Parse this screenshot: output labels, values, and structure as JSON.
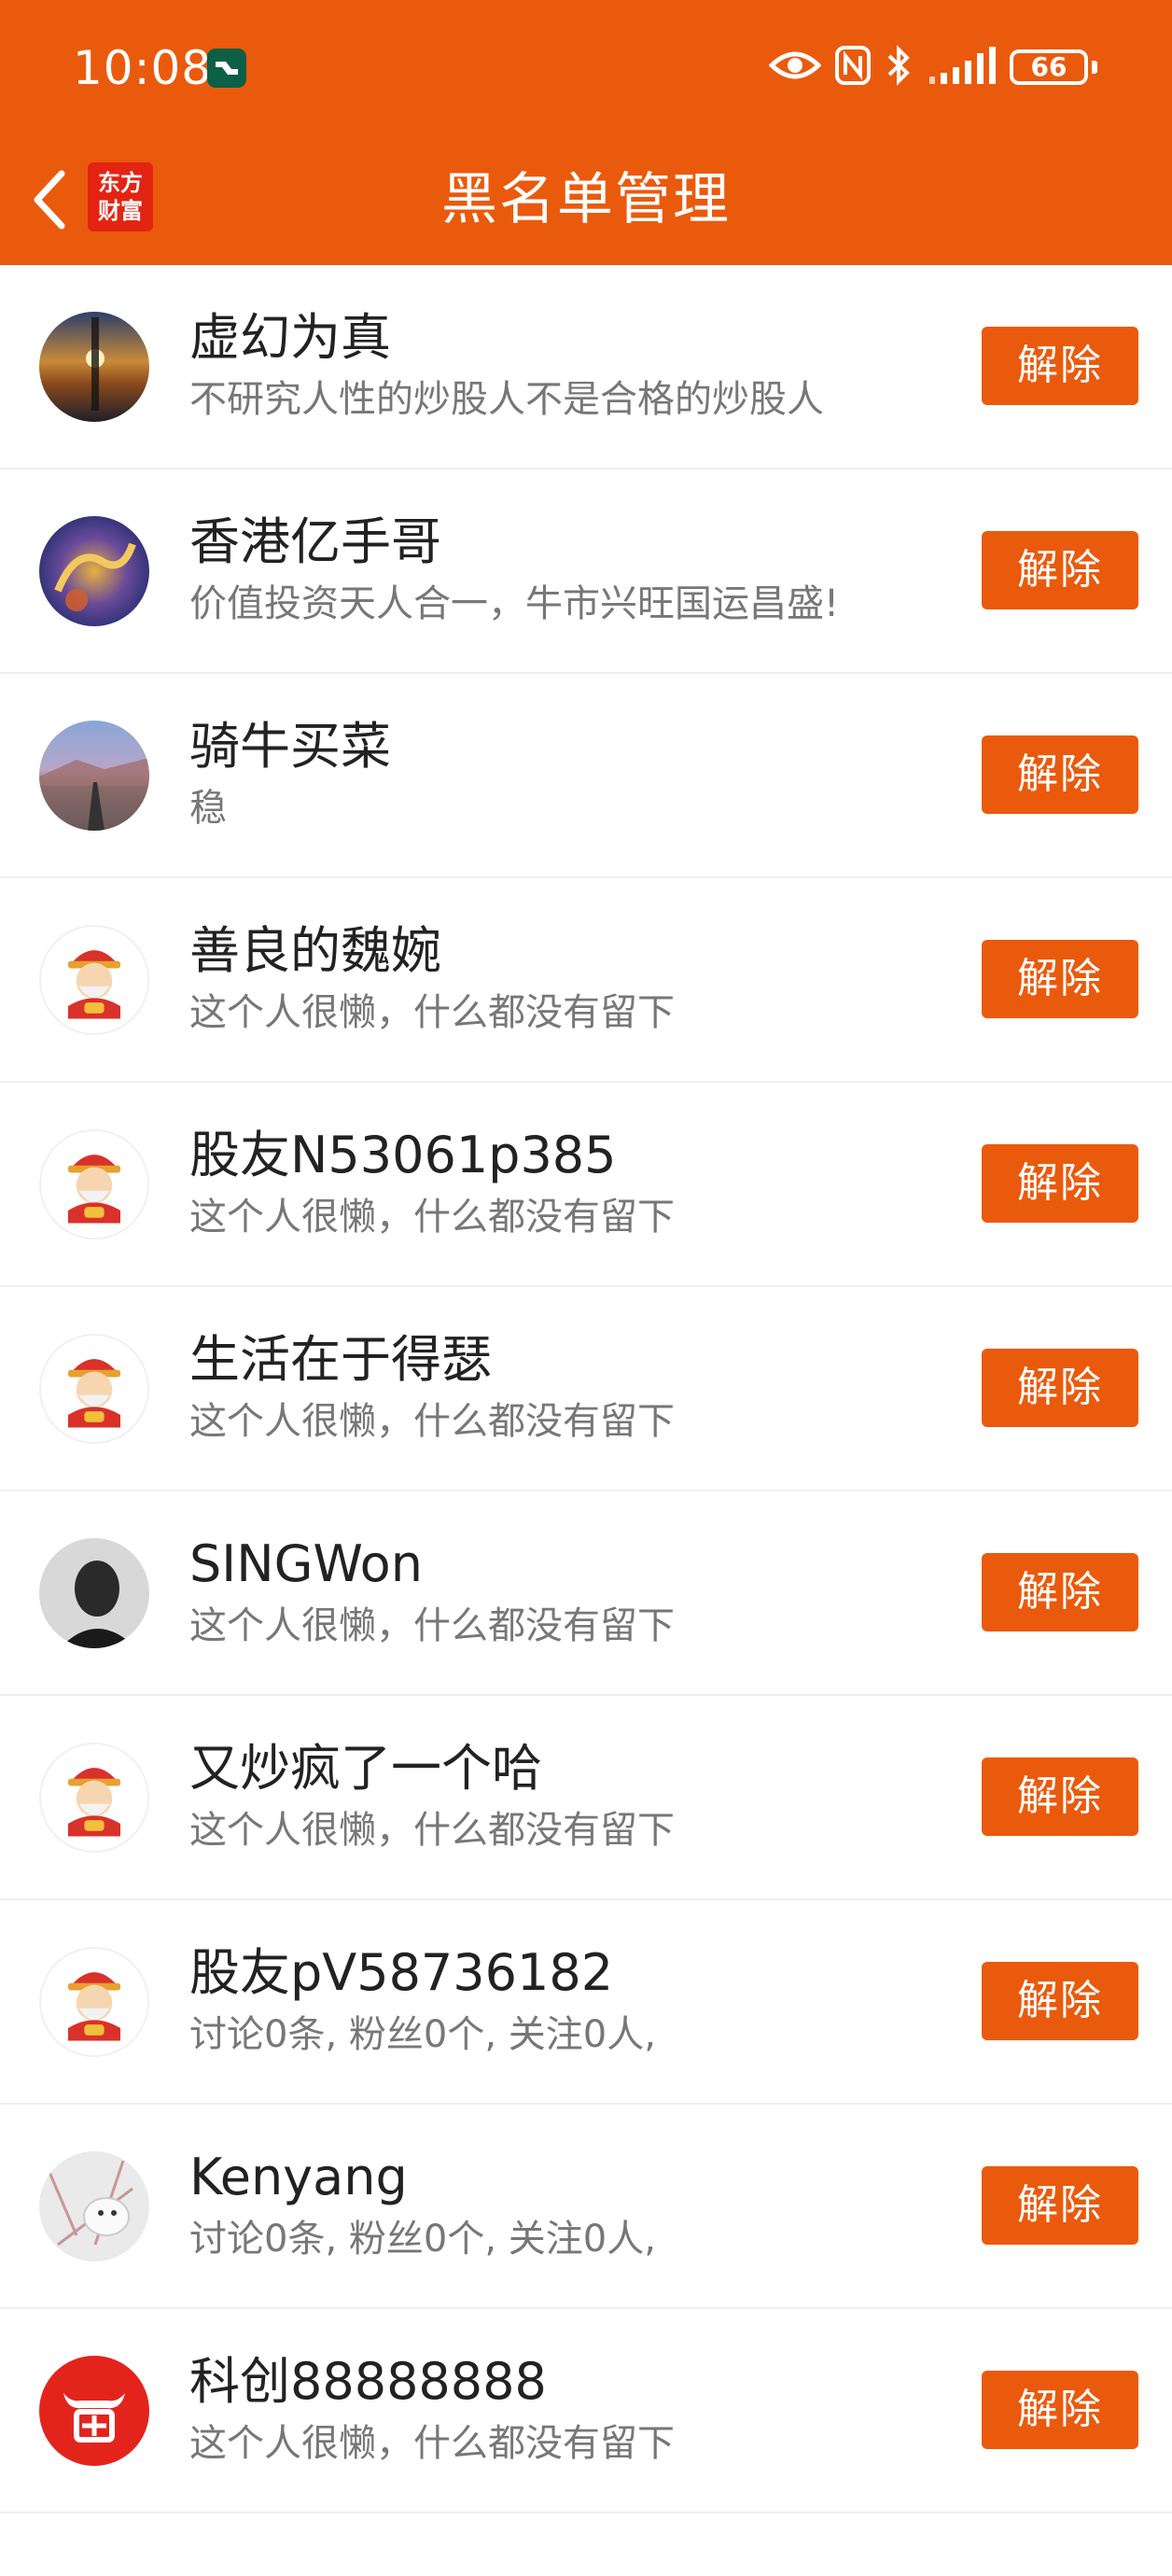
{
  "status_bar": {
    "time": "10:08",
    "battery": "66",
    "icons": [
      "app-notification-icon",
      "eye-icon",
      "nfc-icon",
      "bluetooth-icon",
      "signal-icon",
      "battery-icon"
    ]
  },
  "nav": {
    "title": "黑名单管理",
    "logo_line1": "东方",
    "logo_line2": "财富",
    "back_icon": "chevron-left-icon"
  },
  "colors": {
    "brand": "#ea5a0c",
    "logo_red": "#e32413"
  },
  "blocked_users": [
    {
      "name": "虚幻为真",
      "bio": "不研究人性的炒股人不是合格的炒股人",
      "button": "解除",
      "avatar": "sunset-photo"
    },
    {
      "name": "香港亿手哥",
      "bio": "价值投资天人合一，牛市兴旺国运昌盛!",
      "button": "解除",
      "avatar": "dragon-photo"
    },
    {
      "name": "骑牛买菜",
      "bio": "稳",
      "button": "解除",
      "avatar": "mountain-road-photo"
    },
    {
      "name": "善良的魏婉",
      "bio": "这个人很懒，什么都没有留下",
      "button": "解除",
      "avatar": "fortune-god-default"
    },
    {
      "name": "股友N53061p385",
      "bio": "这个人很懒，什么都没有留下",
      "button": "解除",
      "avatar": "fortune-god-default"
    },
    {
      "name": "生活在于得瑟",
      "bio": "这个人很懒，什么都没有留下",
      "button": "解除",
      "avatar": "fortune-god-default"
    },
    {
      "name": "SINGWon",
      "bio": "这个人很懒，什么都没有留下",
      "button": "解除",
      "avatar": "portrait-photo"
    },
    {
      "name": "又炒疯了一个哈",
      "bio": "这个人很懒，什么都没有留下",
      "button": "解除",
      "avatar": "fortune-god-default"
    },
    {
      "name": "股友pV58736182",
      "bio": "讨论0条, 粉丝0个, 关注0人,",
      "button": "解除",
      "avatar": "fortune-god-default"
    },
    {
      "name": "Kenyang",
      "bio": "讨论0条, 粉丝0个, 关注0人,",
      "button": "解除",
      "avatar": "snow-animal-photo"
    },
    {
      "name": "科创88888888",
      "bio": "这个人很懒，什么都没有留下",
      "button": "解除",
      "avatar": "bull-logo"
    }
  ]
}
